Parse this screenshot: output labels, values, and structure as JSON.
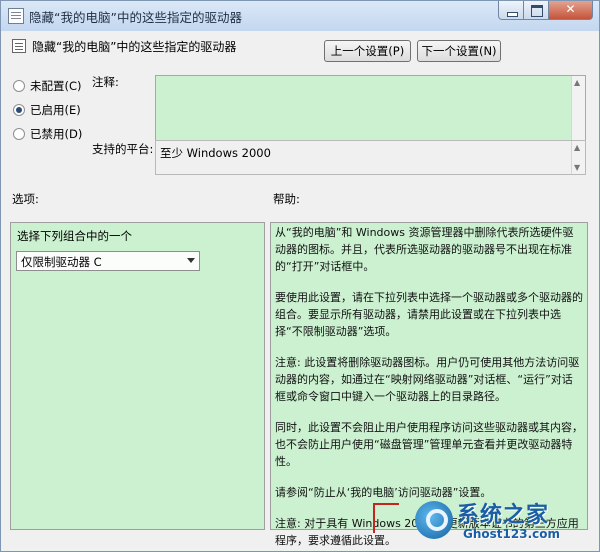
{
  "window": {
    "title": "隐藏“我的电脑”中的这些指定的驱动器"
  },
  "header": {
    "setting_title": "隐藏“我的电脑”中的这些指定的驱动器",
    "prev_button": "上一个设置(P)",
    "next_button": "下一个设置(N)"
  },
  "state_options": [
    {
      "label": "未配置(C)",
      "checked": false
    },
    {
      "label": "已启用(E)",
      "checked": true
    },
    {
      "label": "已禁用(D)",
      "checked": false
    }
  ],
  "fields": {
    "comment_label": "注释:",
    "platform_label": "支持的平台:",
    "platform_value": "至少 Windows 2000"
  },
  "sections": {
    "options_label": "选项:",
    "help_label": "帮助:"
  },
  "options_panel": {
    "caption": "选择下列组合中的一个",
    "selected_value": "仅限制驱动器 C"
  },
  "help_panel": {
    "paragraphs": [
      "从“我的电脑”和 Windows 资源管理器中删除代表所选硬件驱动器的图标。并且，代表所选驱动器的驱动器号不出现在标准的“打开”对话框中。",
      "要使用此设置，请在下拉列表中选择一个驱动器或多个驱动器的组合。要显示所有驱动器，请禁用此设置或在下拉列表中选择“不限制驱动器”选项。",
      "注意: 此设置将删除驱动器图标。用户仍可使用其他方法访问驱动器的内容，如通过在“映射网络驱动器”对话框、“运行”对话框或命令窗口中键入一个驱动器上的目录路径。",
      "同时，此设置不会阻止用户使用程序访问这些驱动器或其内容，也不会防止用户使用“磁盘管理”管理单元查看并更改驱动器特性。",
      "请参阅“防止从‘我的电脑’访问驱动器”设置。",
      "注意: 对于具有 Windows 2000 或更新版本证书的第三方应用程序，要求遵循此设置。"
    ]
  },
  "watermark": {
    "title": "系统之家",
    "url": "Ghost123.com"
  }
}
